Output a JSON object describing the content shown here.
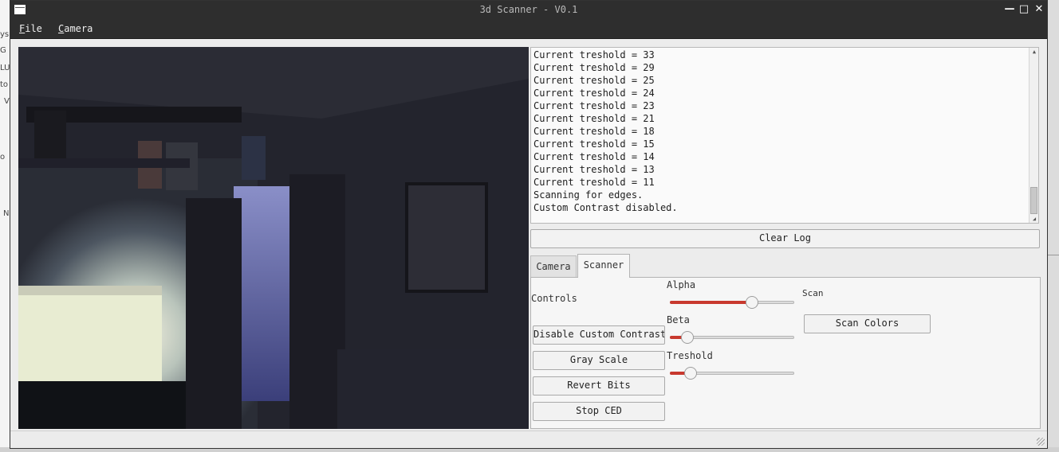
{
  "window": {
    "title": "3d Scanner - V0.1"
  },
  "menu": [
    {
      "mnemonic": "F",
      "rest": "ile"
    },
    {
      "mnemonic": "C",
      "rest": "amera"
    }
  ],
  "desktop_left_text": [
    "ys",
    "G",
    "LU",
    "to",
    "V",
    "o",
    "N"
  ],
  "log": {
    "lines": [
      "Current treshold = 33",
      "Current treshold = 29",
      "Current treshold = 25",
      "Current treshold = 24",
      "Current treshold = 23",
      "Current treshold = 21",
      "Current treshold = 18",
      "Current treshold = 15",
      "Current treshold = 14",
      "Current treshold = 13",
      "Current treshold = 11",
      "Scanning for edges.",
      "Custom Contrast disabled."
    ],
    "scroll_position_fraction": 0.9
  },
  "clear_log_label": "Clear Log",
  "tabs": [
    {
      "label": "Camera",
      "selected": false
    },
    {
      "label": "Scanner",
      "selected": true
    }
  ],
  "scanner": {
    "controls_label": "Controls",
    "buttons": {
      "disable_contrast": "Disable Custom Contrast",
      "gray_scale": "Gray Scale",
      "revert_bits": "Revert Bits",
      "stop_ced": "Stop CED"
    },
    "sliders": {
      "alpha": {
        "label": "Alpha",
        "fraction": 0.68
      },
      "beta": {
        "label": "Beta",
        "fraction": 0.1
      },
      "treshold": {
        "label": "Treshold",
        "fraction": 0.13
      }
    },
    "scan_label": "Scan",
    "scan_colors_label": "Scan Colors"
  },
  "colors": {
    "titlebar": "#2e2e2e",
    "slider_fill": "#c8392e",
    "panel_bg": "#f6f6f6"
  }
}
